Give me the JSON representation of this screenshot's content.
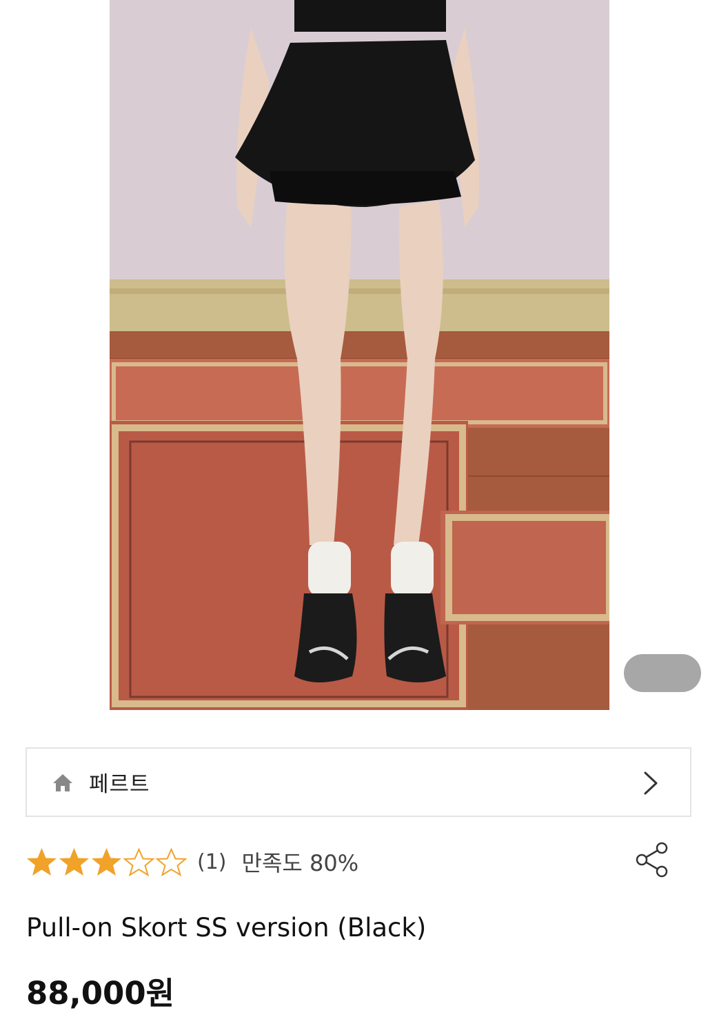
{
  "product": {
    "brand": "페르트",
    "title": "Pull-on Skort SS version (Black)",
    "price": "88,000원",
    "rating": {
      "stars_filled": 3,
      "stars_total": 5,
      "review_count": "(1)",
      "satisfaction": "만족도 80%"
    }
  },
  "icons": {
    "brand_home": "home-icon",
    "brand_chevron": "chevron-right-icon",
    "share": "share-icon"
  },
  "colors": {
    "star": "#f0a229",
    "page_indicator": "#a7a7a7",
    "border": "#e4e4e4"
  }
}
